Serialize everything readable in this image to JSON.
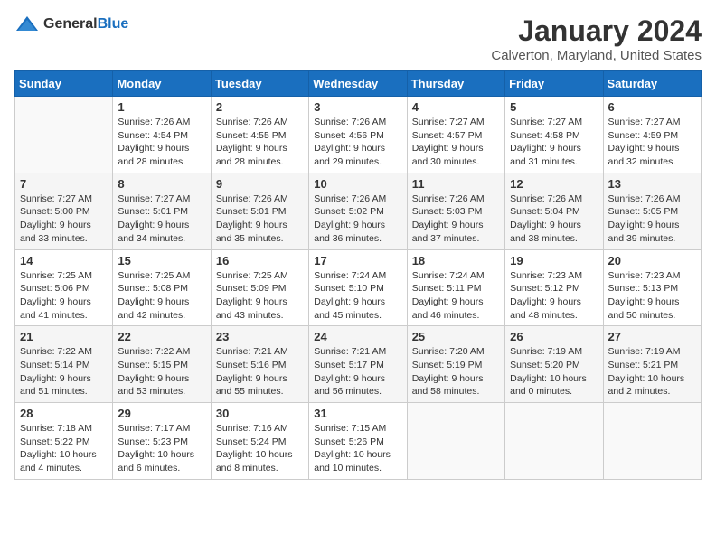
{
  "logo": {
    "general": "General",
    "blue": "Blue"
  },
  "header": {
    "month": "January 2024",
    "location": "Calverton, Maryland, United States"
  },
  "weekdays": [
    "Sunday",
    "Monday",
    "Tuesday",
    "Wednesday",
    "Thursday",
    "Friday",
    "Saturday"
  ],
  "weeks": [
    [
      {
        "day": "",
        "info": ""
      },
      {
        "day": "1",
        "info": "Sunrise: 7:26 AM\nSunset: 4:54 PM\nDaylight: 9 hours\nand 28 minutes."
      },
      {
        "day": "2",
        "info": "Sunrise: 7:26 AM\nSunset: 4:55 PM\nDaylight: 9 hours\nand 28 minutes."
      },
      {
        "day": "3",
        "info": "Sunrise: 7:26 AM\nSunset: 4:56 PM\nDaylight: 9 hours\nand 29 minutes."
      },
      {
        "day": "4",
        "info": "Sunrise: 7:27 AM\nSunset: 4:57 PM\nDaylight: 9 hours\nand 30 minutes."
      },
      {
        "day": "5",
        "info": "Sunrise: 7:27 AM\nSunset: 4:58 PM\nDaylight: 9 hours\nand 31 minutes."
      },
      {
        "day": "6",
        "info": "Sunrise: 7:27 AM\nSunset: 4:59 PM\nDaylight: 9 hours\nand 32 minutes."
      }
    ],
    [
      {
        "day": "7",
        "info": "Sunrise: 7:27 AM\nSunset: 5:00 PM\nDaylight: 9 hours\nand 33 minutes."
      },
      {
        "day": "8",
        "info": "Sunrise: 7:27 AM\nSunset: 5:01 PM\nDaylight: 9 hours\nand 34 minutes."
      },
      {
        "day": "9",
        "info": "Sunrise: 7:26 AM\nSunset: 5:01 PM\nDaylight: 9 hours\nand 35 minutes."
      },
      {
        "day": "10",
        "info": "Sunrise: 7:26 AM\nSunset: 5:02 PM\nDaylight: 9 hours\nand 36 minutes."
      },
      {
        "day": "11",
        "info": "Sunrise: 7:26 AM\nSunset: 5:03 PM\nDaylight: 9 hours\nand 37 minutes."
      },
      {
        "day": "12",
        "info": "Sunrise: 7:26 AM\nSunset: 5:04 PM\nDaylight: 9 hours\nand 38 minutes."
      },
      {
        "day": "13",
        "info": "Sunrise: 7:26 AM\nSunset: 5:05 PM\nDaylight: 9 hours\nand 39 minutes."
      }
    ],
    [
      {
        "day": "14",
        "info": "Sunrise: 7:25 AM\nSunset: 5:06 PM\nDaylight: 9 hours\nand 41 minutes."
      },
      {
        "day": "15",
        "info": "Sunrise: 7:25 AM\nSunset: 5:08 PM\nDaylight: 9 hours\nand 42 minutes."
      },
      {
        "day": "16",
        "info": "Sunrise: 7:25 AM\nSunset: 5:09 PM\nDaylight: 9 hours\nand 43 minutes."
      },
      {
        "day": "17",
        "info": "Sunrise: 7:24 AM\nSunset: 5:10 PM\nDaylight: 9 hours\nand 45 minutes."
      },
      {
        "day": "18",
        "info": "Sunrise: 7:24 AM\nSunset: 5:11 PM\nDaylight: 9 hours\nand 46 minutes."
      },
      {
        "day": "19",
        "info": "Sunrise: 7:23 AM\nSunset: 5:12 PM\nDaylight: 9 hours\nand 48 minutes."
      },
      {
        "day": "20",
        "info": "Sunrise: 7:23 AM\nSunset: 5:13 PM\nDaylight: 9 hours\nand 50 minutes."
      }
    ],
    [
      {
        "day": "21",
        "info": "Sunrise: 7:22 AM\nSunset: 5:14 PM\nDaylight: 9 hours\nand 51 minutes."
      },
      {
        "day": "22",
        "info": "Sunrise: 7:22 AM\nSunset: 5:15 PM\nDaylight: 9 hours\nand 53 minutes."
      },
      {
        "day": "23",
        "info": "Sunrise: 7:21 AM\nSunset: 5:16 PM\nDaylight: 9 hours\nand 55 minutes."
      },
      {
        "day": "24",
        "info": "Sunrise: 7:21 AM\nSunset: 5:17 PM\nDaylight: 9 hours\nand 56 minutes."
      },
      {
        "day": "25",
        "info": "Sunrise: 7:20 AM\nSunset: 5:19 PM\nDaylight: 9 hours\nand 58 minutes."
      },
      {
        "day": "26",
        "info": "Sunrise: 7:19 AM\nSunset: 5:20 PM\nDaylight: 10 hours\nand 0 minutes."
      },
      {
        "day": "27",
        "info": "Sunrise: 7:19 AM\nSunset: 5:21 PM\nDaylight: 10 hours\nand 2 minutes."
      }
    ],
    [
      {
        "day": "28",
        "info": "Sunrise: 7:18 AM\nSunset: 5:22 PM\nDaylight: 10 hours\nand 4 minutes."
      },
      {
        "day": "29",
        "info": "Sunrise: 7:17 AM\nSunset: 5:23 PM\nDaylight: 10 hours\nand 6 minutes."
      },
      {
        "day": "30",
        "info": "Sunrise: 7:16 AM\nSunset: 5:24 PM\nDaylight: 10 hours\nand 8 minutes."
      },
      {
        "day": "31",
        "info": "Sunrise: 7:15 AM\nSunset: 5:26 PM\nDaylight: 10 hours\nand 10 minutes."
      },
      {
        "day": "",
        "info": ""
      },
      {
        "day": "",
        "info": ""
      },
      {
        "day": "",
        "info": ""
      }
    ]
  ]
}
